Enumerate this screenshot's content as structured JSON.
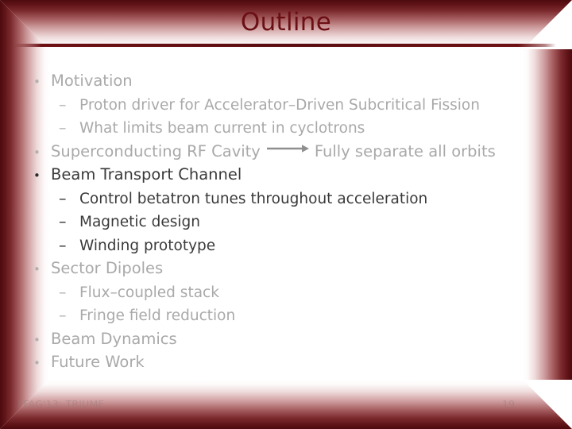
{
  "slide": {
    "title": "Outline",
    "title_color": "#6b0f14",
    "frame_color": "#4d0b0f",
    "dim_text_color": "#a9a9a9",
    "highlight_text_color": "#3a3a3a"
  },
  "outline": [
    {
      "level": 1,
      "marker": "•",
      "text": "Motivation",
      "emphasis": "dim"
    },
    {
      "level": 2,
      "marker": "–",
      "text": "Proton driver for Accelerator–Driven Subcritical Fission",
      "emphasis": "dim"
    },
    {
      "level": 2,
      "marker": "–",
      "text": "What limits beam current in cyclotrons",
      "emphasis": "dim"
    },
    {
      "level": 1,
      "marker": "•",
      "text": "Superconducting RF Cavity",
      "emphasis": "dim",
      "arrow": true,
      "after_arrow": "Fully separate all orbits"
    },
    {
      "level": 1,
      "marker": "•",
      "text": "Beam Transport Channel",
      "emphasis": "dark"
    },
    {
      "level": 2,
      "marker": "–",
      "text": "Control betatron tunes throughout acceleration",
      "emphasis": "dark"
    },
    {
      "level": 2,
      "marker": "–",
      "text": "Magnetic design",
      "emphasis": "dark"
    },
    {
      "level": 2,
      "marker": "–",
      "text": "Winding prototype",
      "emphasis": "dark"
    },
    {
      "level": 1,
      "marker": "•",
      "text": "Sector Dipoles",
      "emphasis": "dim"
    },
    {
      "level": 2,
      "marker": "–",
      "text": "Flux–coupled stack",
      "emphasis": "dim"
    },
    {
      "level": 2,
      "marker": "–",
      "text": "Fringe field reduction",
      "emphasis": "dim"
    },
    {
      "level": 1,
      "marker": "•",
      "text": "Beam Dynamics",
      "emphasis": "dim"
    },
    {
      "level": 1,
      "marker": "•",
      "text": "Future Work",
      "emphasis": "dim"
    }
  ],
  "footer": {
    "left": "FFAG'13: TRIUMF",
    "page": "19"
  }
}
